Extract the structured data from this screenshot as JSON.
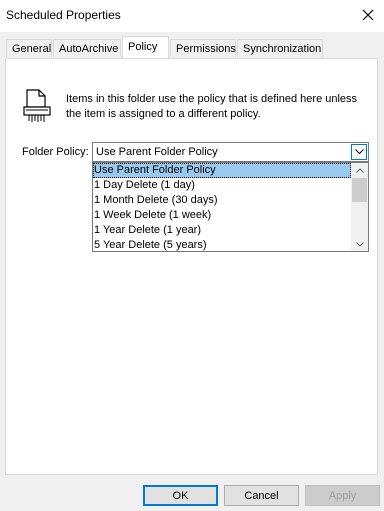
{
  "window": {
    "title": "Scheduled Properties"
  },
  "tabs": [
    {
      "label": "General"
    },
    {
      "label": "AutoArchive"
    },
    {
      "label": "Policy"
    },
    {
      "label": "Permissions"
    },
    {
      "label": "Synchronization"
    }
  ],
  "active_tab": "Policy",
  "policy": {
    "description": "Items in this folder use the policy that is defined here unless the item is assigned to a different policy.",
    "folder_policy_label": "Folder Policy:",
    "selected_value": "Use Parent Folder Policy",
    "options": [
      {
        "label": "Use Parent Folder Policy"
      },
      {
        "label": "1 Day Delete (1 day)"
      },
      {
        "label": "1 Month Delete (30 days)"
      },
      {
        "label": "1 Week Delete (1 week)"
      },
      {
        "label": "1 Year Delete (1 year)"
      },
      {
        "label": "5 Year Delete (5 years)"
      }
    ]
  },
  "buttons": {
    "ok": "OK",
    "cancel": "Cancel",
    "apply": "Apply"
  },
  "icons": {
    "close": "close-icon",
    "policy": "document-shredder-icon",
    "dropdown": "chevron-down-icon"
  },
  "colors": {
    "accent": "#0078d7",
    "selection": "#99c9ef"
  }
}
